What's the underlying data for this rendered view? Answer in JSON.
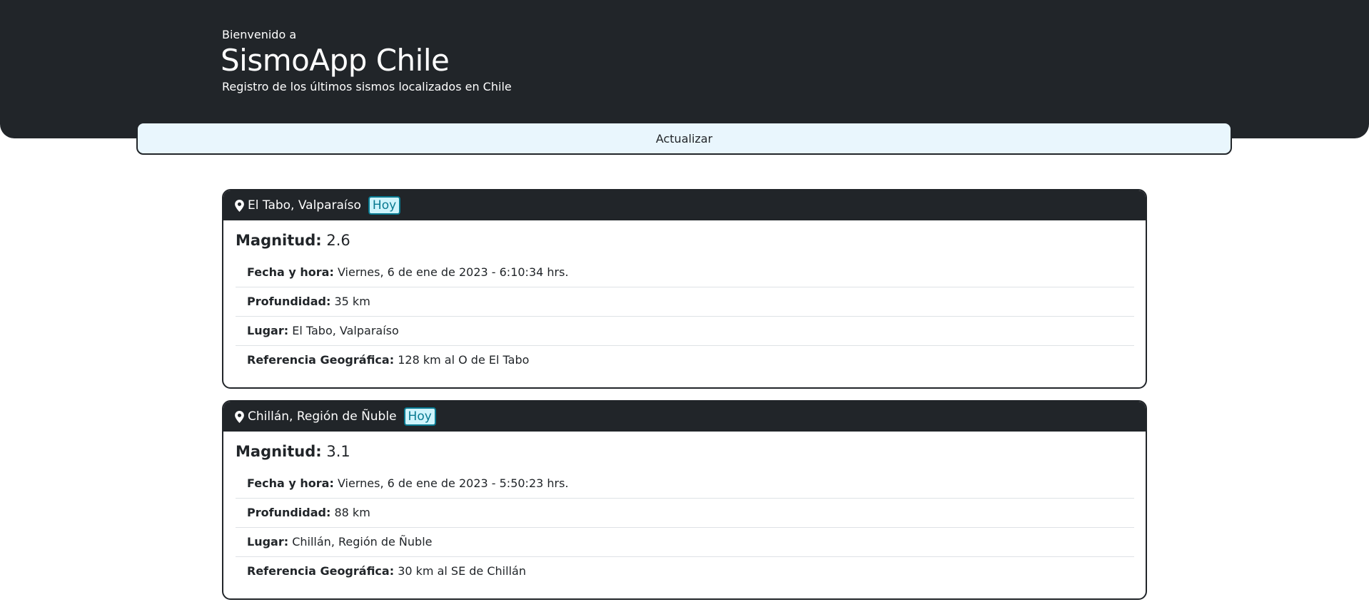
{
  "header": {
    "pretitle": "Bienvenido a",
    "title": "SismoApp Chile",
    "subtitle": "Registro de los últimos sismos localizados en Chile"
  },
  "refresh_label": "Actualizar",
  "labels": {
    "magnitude": "Magnitud:",
    "datetime": "Fecha y hora:",
    "depth": "Profundidad:",
    "place": "Lugar:",
    "reference": "Referencia Geográfica:"
  },
  "quakes": [
    {
      "location": "El Tabo, Valparaíso",
      "badge": "Hoy",
      "magnitude": "2.6",
      "datetime": "Viernes, 6 de ene de 2023 - 6:10:34 hrs.",
      "depth": "35 km",
      "place": "El Tabo, Valparaíso",
      "reference": "128 km al O de El Tabo"
    },
    {
      "location": "Chillán, Región de Ñuble",
      "badge": "Hoy",
      "magnitude": "3.1",
      "datetime": "Viernes, 6 de ene de 2023 - 5:50:23 hrs.",
      "depth": "88 km",
      "place": "Chillán, Región de Ñuble",
      "reference": "30 km al SE de Chillán"
    }
  ]
}
